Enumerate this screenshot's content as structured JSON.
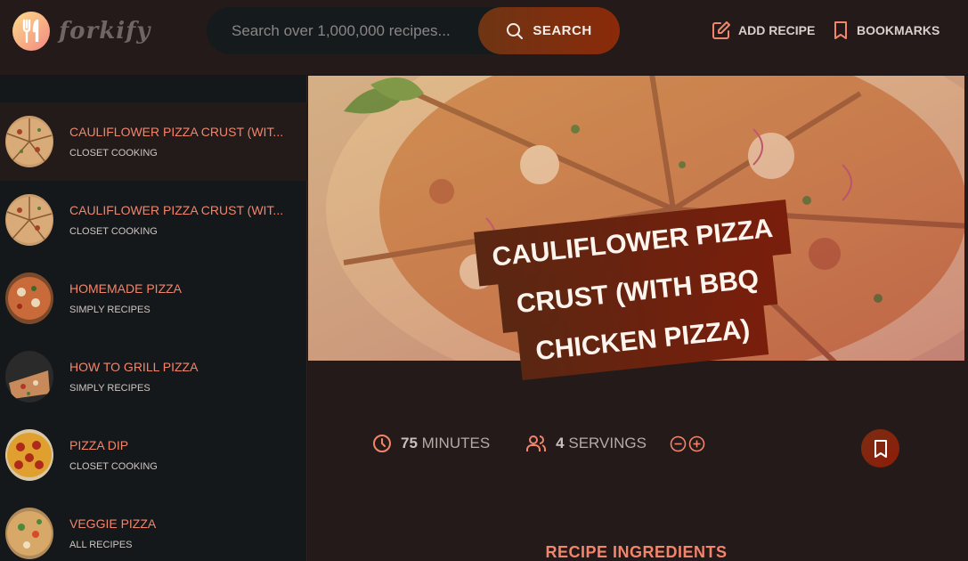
{
  "header": {
    "logo_text": "forkify",
    "search_placeholder": "Search over 1,000,000 recipes...",
    "search_label": "SEARCH",
    "add_recipe_label": "ADD RECIPE",
    "bookmarks_label": "BOOKMARKS"
  },
  "results": [
    {
      "title": "CAULIFLOWER PIZZA CRUST (WIT...",
      "publisher": "CLOSET COOKING",
      "active": true
    },
    {
      "title": "CAULIFLOWER PIZZA CRUST (WIT...",
      "publisher": "CLOSET COOKING",
      "active": false
    },
    {
      "title": "HOMEMADE PIZZA",
      "publisher": "SIMPLY RECIPES",
      "active": false
    },
    {
      "title": "HOW TO GRILL PIZZA",
      "publisher": "SIMPLY RECIPES",
      "active": false
    },
    {
      "title": "PIZZA DIP",
      "publisher": "CLOSET COOKING",
      "active": false
    },
    {
      "title": "VEGGIE PIZZA",
      "publisher": "ALL RECIPES",
      "active": false
    }
  ],
  "recipe": {
    "title_lines": [
      "CAULIFLOWER PIZZA",
      "CRUST (WITH BBQ",
      "CHICKEN PIZZA)"
    ],
    "minutes": "75",
    "minutes_label": "MINUTES",
    "servings": "4",
    "servings_label": "SERVINGS",
    "ingredients_heading": "RECIPE INGREDIENTS"
  },
  "colors": {
    "accent": "#f2856b",
    "button_dark": "#7a2e12",
    "sidebar_bg": "#15181b",
    "header_bg": "#241a19"
  },
  "icons": [
    "forkify-logo-icon",
    "search-icon",
    "edit-icon",
    "bookmark-icon",
    "clock-icon",
    "users-icon",
    "minus-circle-icon",
    "plus-circle-icon"
  ]
}
